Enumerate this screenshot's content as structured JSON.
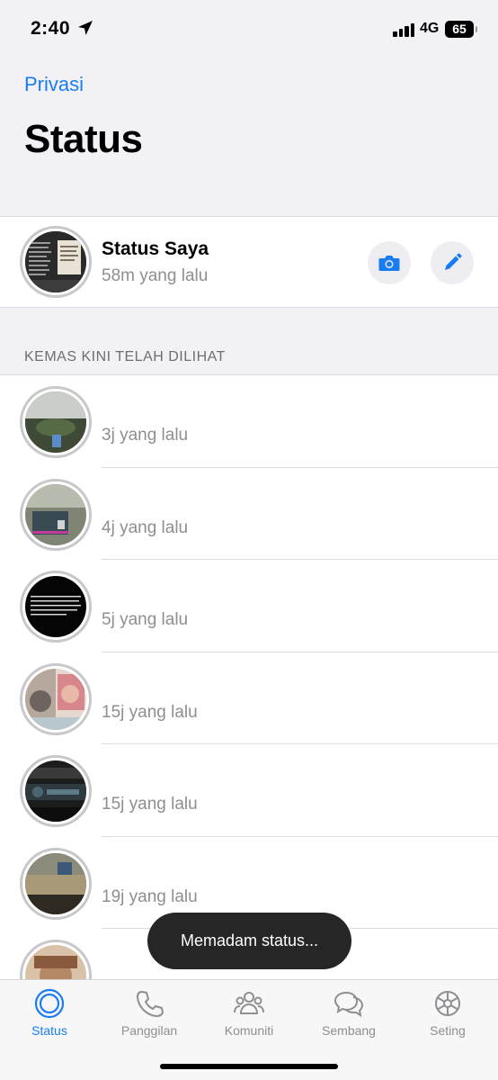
{
  "status_bar": {
    "time": "2:40",
    "network": "4G",
    "battery": "65"
  },
  "header": {
    "back_label": "Privasi",
    "title": "Status"
  },
  "my_status": {
    "name": "Status Saya",
    "time": "58m yang lalu",
    "camera_icon": "camera-icon",
    "edit_icon": "pencil-icon"
  },
  "section": {
    "viewed_header": "KEMAS KINI TELAH DILIHAT"
  },
  "updates": [
    {
      "time": "3j yang lalu"
    },
    {
      "time": "4j yang lalu"
    },
    {
      "time": "5j yang lalu"
    },
    {
      "time": "15j yang lalu"
    },
    {
      "time": "15j yang lalu"
    },
    {
      "time": "19j yang lalu"
    },
    {
      "time": ""
    }
  ],
  "toast": {
    "text": "Memadam status..."
  },
  "tabs": [
    {
      "label": "Status",
      "icon": "status-ring-icon",
      "active": true
    },
    {
      "label": "Panggilan",
      "icon": "phone-icon",
      "active": false
    },
    {
      "label": "Komuniti",
      "icon": "community-icon",
      "active": false
    },
    {
      "label": "Sembang",
      "icon": "chat-bubbles-icon",
      "active": false
    },
    {
      "label": "Seting",
      "icon": "gear-icon",
      "active": false
    }
  ],
  "colors": {
    "accent": "#1a7cf3",
    "secondary_text": "#8e8e93",
    "background": "#f2f2f6"
  }
}
